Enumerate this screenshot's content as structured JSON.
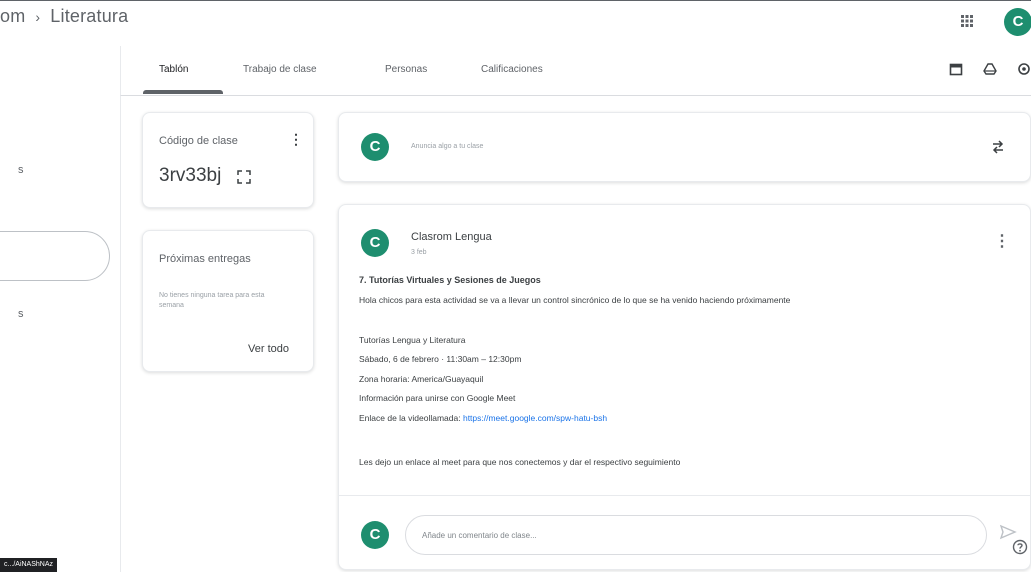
{
  "breadcrumb": {
    "parent": "om",
    "separator": "›",
    "current": "Literatura"
  },
  "account": {
    "initial": "C"
  },
  "tabs": [
    {
      "label": "Tablón",
      "active": true
    },
    {
      "label": "Trabajo de clase",
      "active": false
    },
    {
      "label": "Personas",
      "active": false
    },
    {
      "label": "Calificaciones",
      "active": false
    }
  ],
  "toolbar_icons": [
    "calendar-icon",
    "drive-icon",
    "settings-icon"
  ],
  "sidebar": {
    "partial_item_1": "s",
    "partial_item_2": "s"
  },
  "class_code": {
    "title": "Código de clase",
    "value": "3rv33bj",
    "more": "⋮"
  },
  "upcoming": {
    "title": "Próximas entregas",
    "empty_text": "No tienes ninguna tarea para esta semana",
    "view_all": "Ver todo"
  },
  "announce": {
    "initial": "C",
    "placeholder": "Anuncia algo a tu clase"
  },
  "post": {
    "initial": "C",
    "author": "Clasrom Lengua",
    "time": "3 feb",
    "heading": "7. Tutorías Virtuales y Sesiones de Juegos",
    "lines": [
      "Hola chicos para esta actividad se va a llevar un control sincrónico de lo que se ha venido haciendo próximamente",
      "Tutorías Lengua y Literatura",
      "Sábado, 6 de febrero · 11:30am – 12:30pm",
      "Zona horaria: America/Guayaquil",
      "Información para unirse con Google Meet",
      "Les dejo un enlace al meet para que nos conectemos y dar el respectivo seguimiento"
    ],
    "link_label": "Enlace de la videollamada:",
    "link_url": "https://meet.google.com/spw-hatu-bsh",
    "more": "⋮"
  },
  "comment": {
    "initial": "C",
    "placeholder": "Añade un comentario de clase..."
  },
  "status_tip": "c.../AiNAShNAz"
}
